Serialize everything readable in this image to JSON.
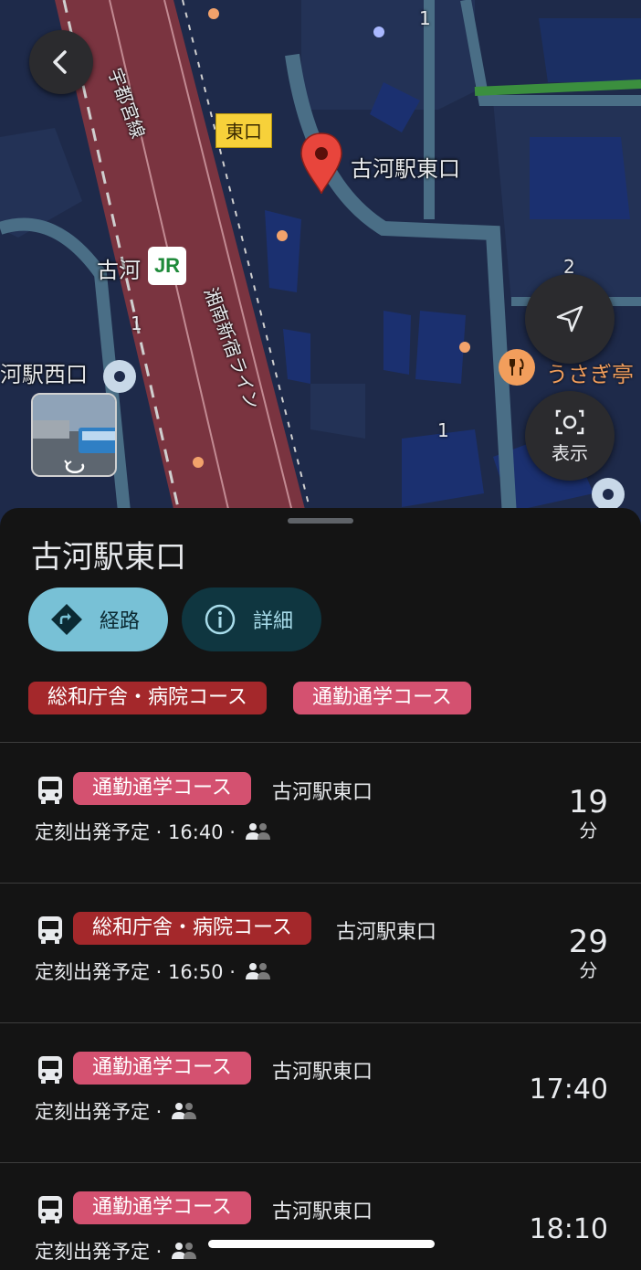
{
  "map": {
    "back_label": "",
    "place_pin_label": "古河駅東口",
    "east_exit_tag": "東口",
    "station_label": "古河",
    "jr_badge": "JR",
    "rail_label_utsunomiya": "宇都宮線",
    "rail_label_shonan": "湘南新宿ライン",
    "west_exit_label": "河駅西口",
    "restaurant_label": "うさぎ亭",
    "route_numbers": [
      "1",
      "2",
      "1",
      "1"
    ],
    "display_button_label": "表示",
    "colors": {
      "map_bg": "#1e2a4a",
      "rail": "#7a3440",
      "pin": "#e8453c",
      "restaurant": "#f29e5c"
    }
  },
  "sheet": {
    "title": "古河駅東口",
    "route_button_label": "経路",
    "detail_button_label": "詳細",
    "filter_chips": [
      {
        "label": "総和庁舎・病院コース",
        "color": "#a4282b"
      },
      {
        "label": "通勤通学コース",
        "color": "#d45170"
      }
    ],
    "departures": [
      {
        "route": "通勤通学コース",
        "route_color": "#d45170",
        "destination": "古河駅東口",
        "schedule": "定刻出発予定 · 16:40 ·",
        "eta_number": "19",
        "eta_unit": "分"
      },
      {
        "route": "総和庁舎・病院コース",
        "route_color": "#a4282b",
        "destination": "古河駅東口",
        "schedule": "定刻出発予定 · 16:50 ·",
        "eta_number": "29",
        "eta_unit": "分"
      },
      {
        "route": "通勤通学コース",
        "route_color": "#d45170",
        "destination": "古河駅東口",
        "schedule": "定刻出発予定 ·",
        "time": "17:40"
      },
      {
        "route": "通勤通学コース",
        "route_color": "#d45170",
        "destination": "古河駅東口",
        "schedule": "定刻出発予定 ·",
        "time": "18:10"
      }
    ]
  }
}
